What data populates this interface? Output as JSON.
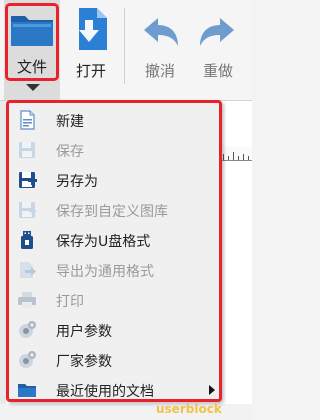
{
  "toolbar": {
    "file_label": "文件",
    "open_label": "打开",
    "undo_label": "撤消",
    "redo_label": "重做"
  },
  "file_menu": {
    "items": [
      {
        "label": "新建",
        "icon": "new-document-icon",
        "enabled": true
      },
      {
        "label": "保存",
        "icon": "save-icon",
        "enabled": false
      },
      {
        "label": "另存为",
        "icon": "save-as-icon",
        "enabled": true
      },
      {
        "label": "保存到自定义图库",
        "icon": "save-to-library-icon",
        "enabled": false
      },
      {
        "label": "保存为U盘格式",
        "icon": "usb-drive-icon",
        "enabled": true
      },
      {
        "label": "导出为通用格式",
        "icon": "export-icon",
        "enabled": false
      },
      {
        "label": "打印",
        "icon": "printer-icon",
        "enabled": false
      },
      {
        "label": "用户参数",
        "icon": "user-settings-icon",
        "enabled": true
      },
      {
        "label": "厂家参数",
        "icon": "factory-settings-icon",
        "enabled": true
      },
      {
        "label": "最近使用的文档",
        "icon": "folder-icon",
        "enabled": true,
        "submenu": true
      }
    ]
  },
  "watermark": "userblock",
  "colors": {
    "highlight_red": "#e8222a",
    "icon_blue": "#1e5fa8",
    "arrow_blue": "#5b8fc7",
    "disabled_text": "#9a9a9a"
  }
}
